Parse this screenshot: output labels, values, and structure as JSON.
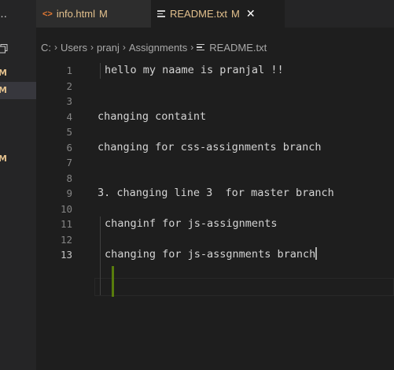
{
  "activity": {
    "more_icon": "…",
    "badges": [
      "M",
      "M",
      "M"
    ]
  },
  "tabs": [
    {
      "label": "info.html",
      "status": "M",
      "icon": "html-file-icon"
    },
    {
      "label": "README.txt",
      "status": "M",
      "close": "✕",
      "icon": "text-file-icon"
    }
  ],
  "breadcrumb": {
    "parts": [
      "C:",
      "Users",
      "pranj",
      "Assignments",
      "README.txt"
    ],
    "separator": "›"
  },
  "editor": {
    "lines": [
      {
        "num": "1",
        "text": "hello my naame is pranjal !!"
      },
      {
        "num": "2",
        "text": ""
      },
      {
        "num": "3",
        "text": ""
      },
      {
        "num": "4",
        "text": "changing containt"
      },
      {
        "num": "5",
        "text": ""
      },
      {
        "num": "6",
        "text": "changing for css-assignments branch"
      },
      {
        "num": "7",
        "text": ""
      },
      {
        "num": "8",
        "text": ""
      },
      {
        "num": "9",
        "text": "3. changing line 3  for master branch"
      },
      {
        "num": "10",
        "text": ""
      },
      {
        "num": "11",
        "text": "changinf for js-assignments"
      },
      {
        "num": "12",
        "text": ""
      },
      {
        "num": "13",
        "text": "changing for js-assgnments branch"
      }
    ],
    "active_line": 13,
    "colors": {
      "background": "#1e1e1e",
      "modified_gutter": "#587c0c",
      "modified_label": "#e2c08d"
    }
  }
}
